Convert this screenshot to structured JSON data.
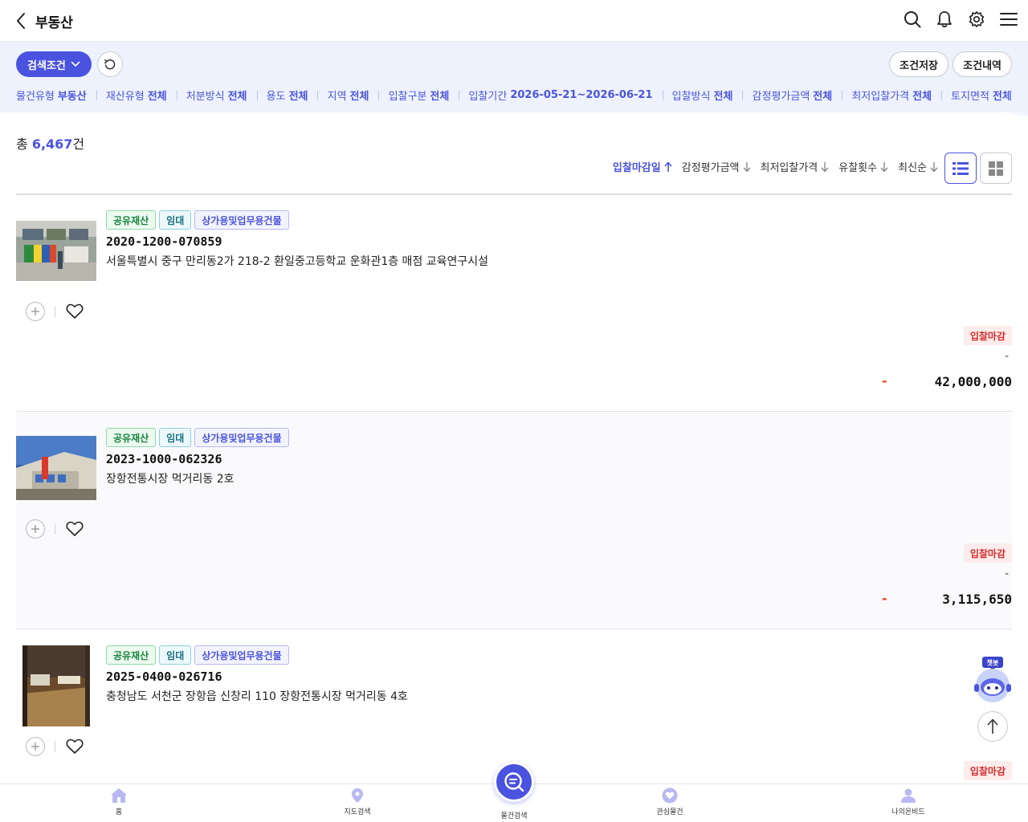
{
  "header": {
    "title": "부동산"
  },
  "filters": {
    "search_condition_label": "검색조건",
    "save_label": "조건저장",
    "history_label": "조건내역",
    "chips": [
      {
        "key": "물건유형",
        "value": "부동산"
      },
      {
        "key": "재산유형",
        "value": "전체"
      },
      {
        "key": "처분방식",
        "value": "전체"
      },
      {
        "key": "용도",
        "value": "전체"
      },
      {
        "key": "지역",
        "value": "전체"
      },
      {
        "key": "입찰구분",
        "value": "전체"
      },
      {
        "key": "입찰기간",
        "value": "2026-05-21~2026-06-21"
      },
      {
        "key": "입찰방식",
        "value": "전체"
      },
      {
        "key": "감정평가금액",
        "value": "전체"
      },
      {
        "key": "최저입찰가격",
        "value": "전체"
      },
      {
        "key": "토지면적",
        "value": "전체"
      }
    ]
  },
  "summary": {
    "prefix": "총 ",
    "count": "6,467",
    "suffix": "건"
  },
  "sort": {
    "options": [
      {
        "label": "입찰마감일",
        "arrow": "up"
      },
      {
        "label": "감정평가금액",
        "arrow": "down"
      },
      {
        "label": "최저입찰가격",
        "arrow": "down"
      },
      {
        "label": "유찰횟수",
        "arrow": "down"
      },
      {
        "label": "최신순",
        "arrow": "down"
      }
    ]
  },
  "items": [
    {
      "tags": [
        "공유재산",
        "임대",
        "상가용및업무용건물"
      ],
      "number": "2020-1200-070859",
      "address": "서울특별시 중구 만리동2가 218-2 환일중고등학교 운화관1층 매점 교육연구시설",
      "status": "입찰마감",
      "dash_top": "-",
      "dash_price": "-",
      "price": "42,000,000"
    },
    {
      "tags": [
        "공유재산",
        "임대",
        "상가용및업무용건물"
      ],
      "number": "2023-1000-062326",
      "address": "장항전통시장 먹거리동 2호",
      "status": "입찰마감",
      "dash_top": "-",
      "dash_price": "-",
      "price": "3,115,650"
    },
    {
      "tags": [
        "공유재산",
        "임대",
        "상가용및업무용건물"
      ],
      "number": "2025-0400-026716",
      "address": "충청남도 서천군 장항읍 신창리 110 장항전통시장 먹거리동 4호",
      "status": "입찰마감"
    }
  ],
  "chatbot": {
    "badge": "챗봇"
  },
  "bottom_nav": {
    "home": "홈",
    "map": "지도검색",
    "search": "물건검색",
    "favorites": "관심물건",
    "my": "나의온비드"
  },
  "colors": {
    "accent": "#4a53e0",
    "status_red": "#d92b2b",
    "band_bg": "#eef2fd"
  }
}
